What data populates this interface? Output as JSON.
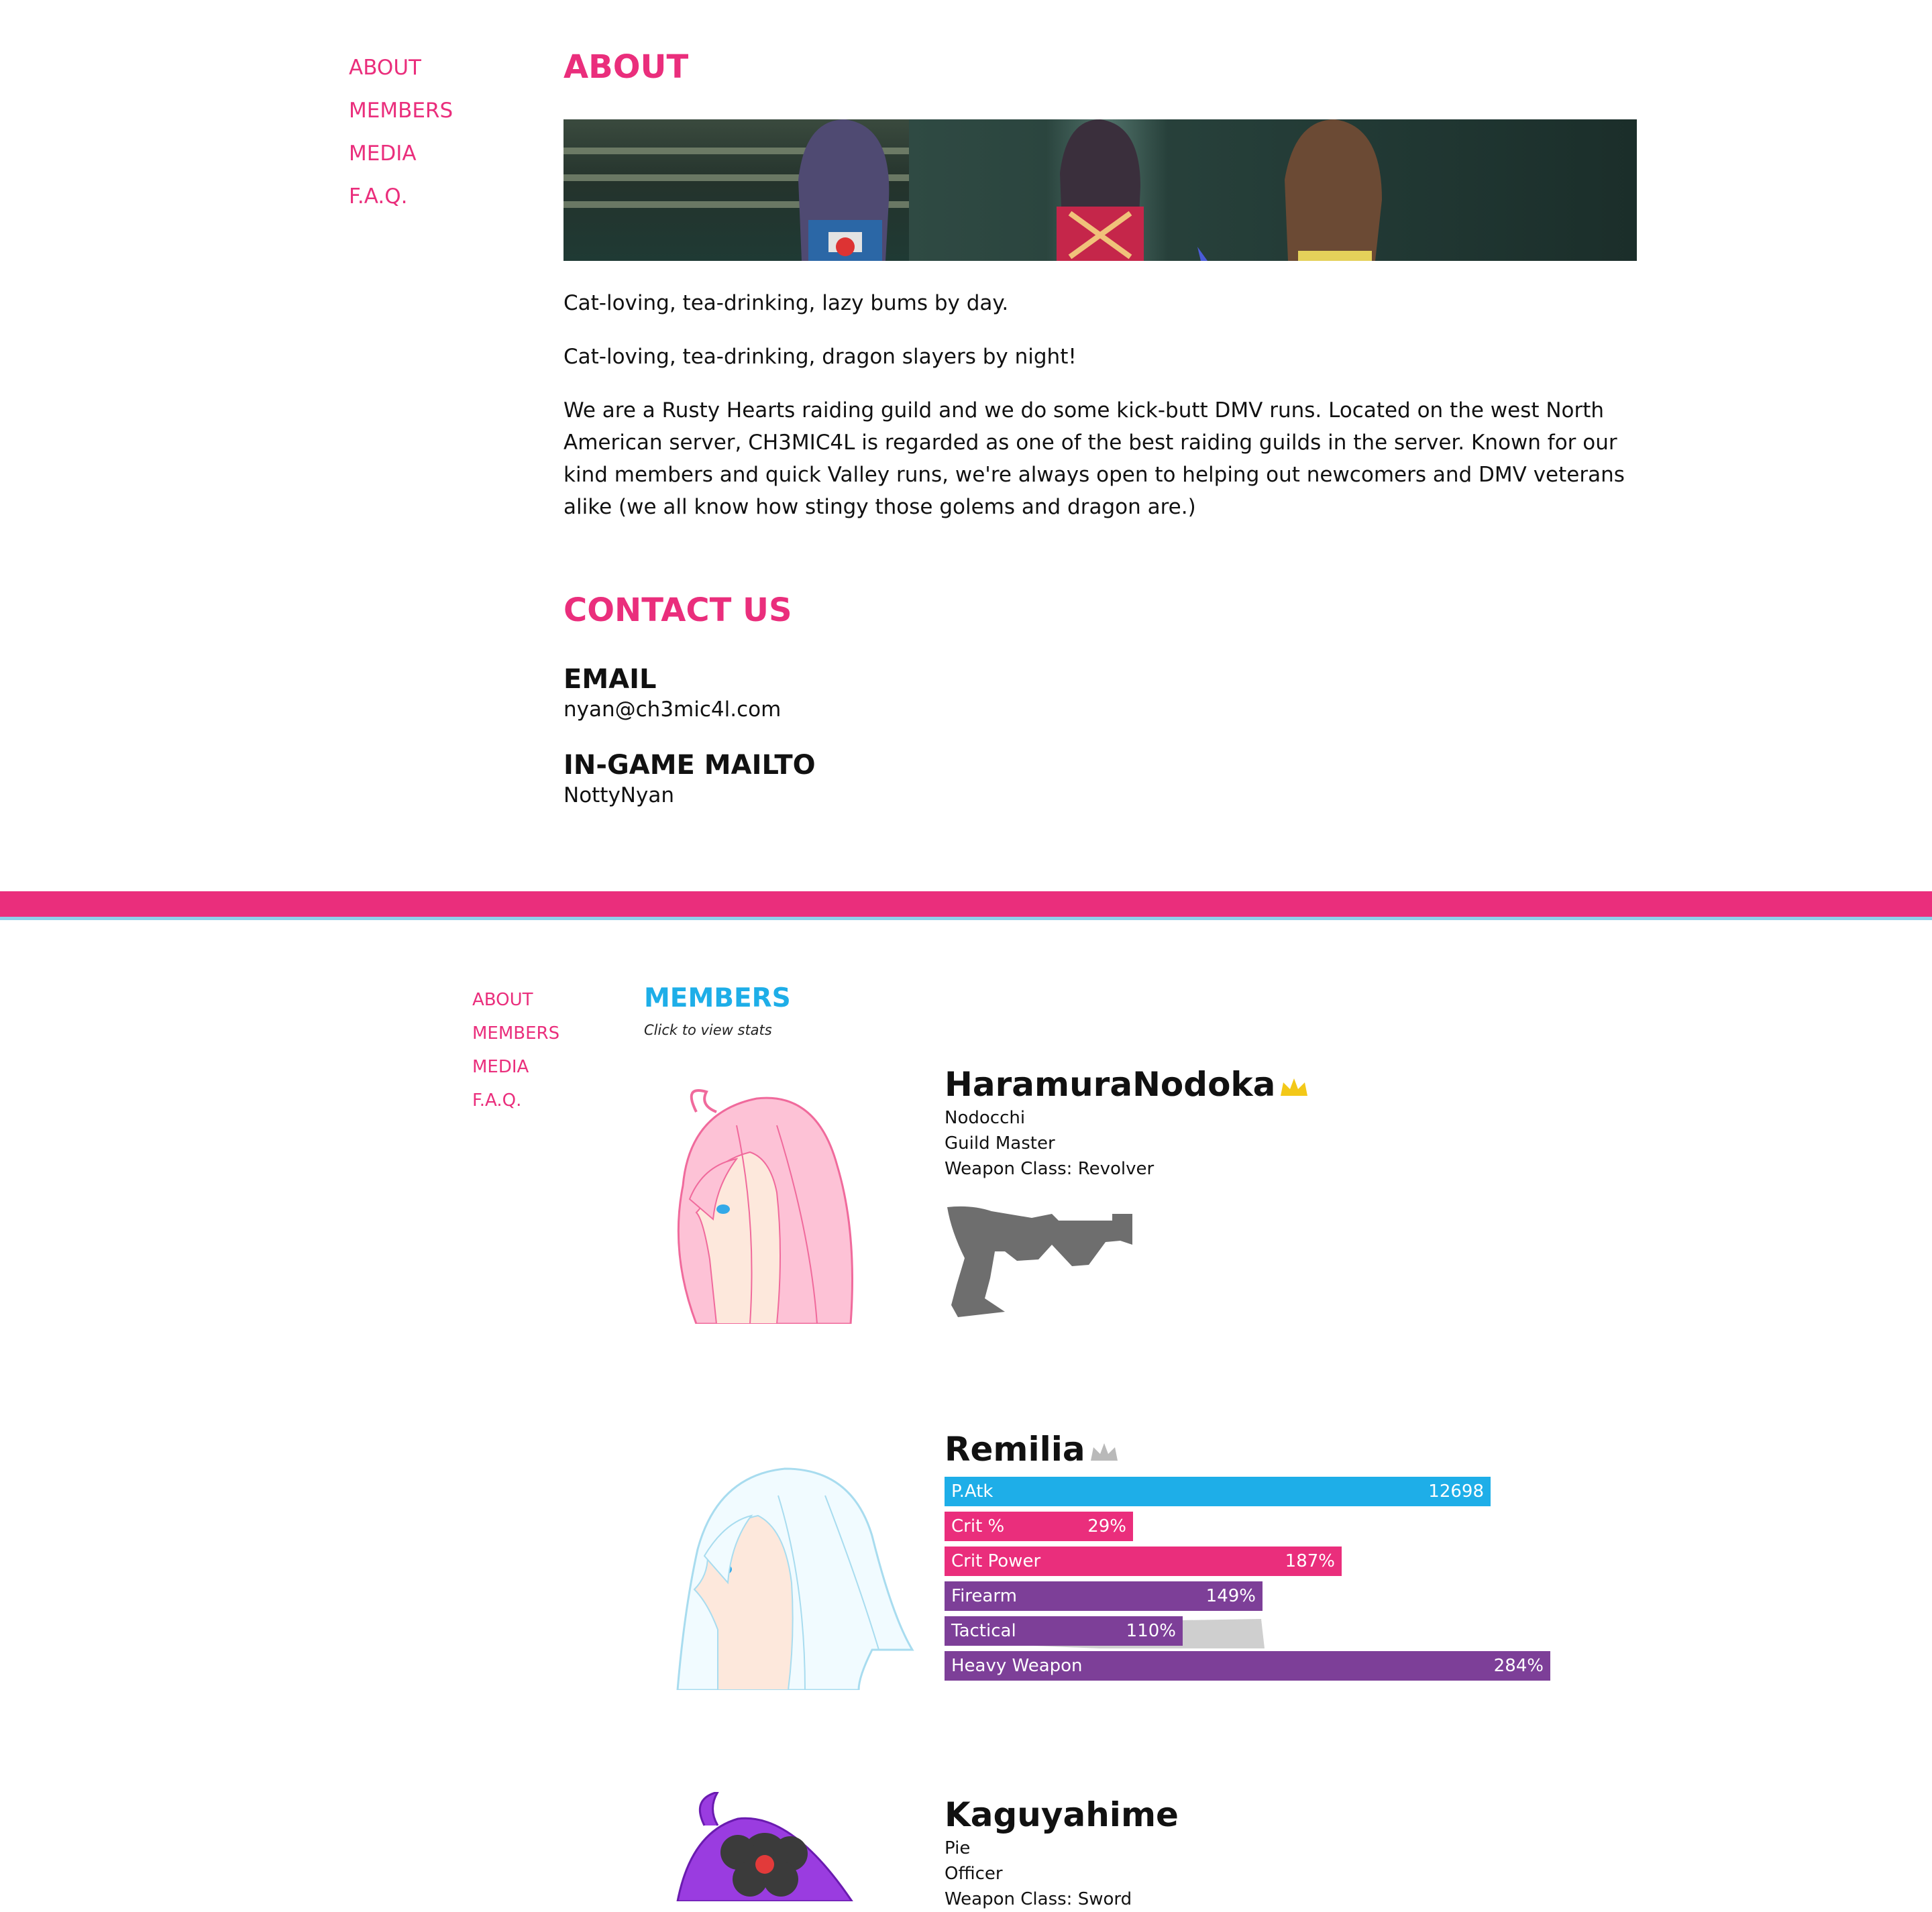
{
  "nav": {
    "items": [
      {
        "label": "ABOUT"
      },
      {
        "label": "MEMBERS"
      },
      {
        "label": "MEDIA"
      },
      {
        "label": "F.A.Q."
      }
    ]
  },
  "about": {
    "title": "ABOUT",
    "paragraphs": [
      "Cat-loving, tea-drinking, lazy bums by day.",
      "Cat-loving, tea-drinking, dragon slayers by night!",
      "We are a Rusty Hearts raiding guild and we do some kick-butt DMV runs. Located on the west North American server, CH3MIC4L is regarded as one of the best raiding guilds in the server. Known for our kind members and quick Valley runs, we're always open to helping out newcomers and DMV veterans alike (we all know how stingy those golems and dragon are.)"
    ]
  },
  "contact": {
    "title": "CONTACT US",
    "email_label": "EMAIL",
    "email_value": "nyan@ch3mic4l.com",
    "mailto_label": "IN-GAME MAILTO",
    "mailto_value": "NottyNyan"
  },
  "members": {
    "title": "MEMBERS",
    "subtitle": "Click to view stats",
    "list": [
      {
        "name": "HaramuraNodoka",
        "nickname": "Nodocchi",
        "rank": "Guild Master",
        "weapon_class": "Weapon Class: Revolver"
      },
      {
        "name": "Remilia",
        "stats": [
          {
            "label": "P.Atk",
            "value": "12698",
            "fraction": 0.55
          },
          {
            "label": "Crit %",
            "value": "29%",
            "fraction": 0.19
          },
          {
            "label": "Crit Power",
            "value": "187%",
            "fraction": 0.4
          },
          {
            "label": "Firearm",
            "value": "149%",
            "fraction": 0.32
          },
          {
            "label": "Tactical",
            "value": "110%",
            "fraction": 0.24
          },
          {
            "label": "Heavy Weapon",
            "value": "284%",
            "fraction": 0.61
          }
        ]
      },
      {
        "name": "Kaguyahime",
        "nickname": "Pie",
        "rank": "Officer",
        "weapon_class": "Weapon Class: Sword"
      }
    ]
  },
  "colors": {
    "pink": "#ea2e7c",
    "blue": "#1eaee8",
    "purple": "#7d3f98",
    "crown_gold": "#f3c818",
    "crown_grey": "#b9b9b9"
  }
}
